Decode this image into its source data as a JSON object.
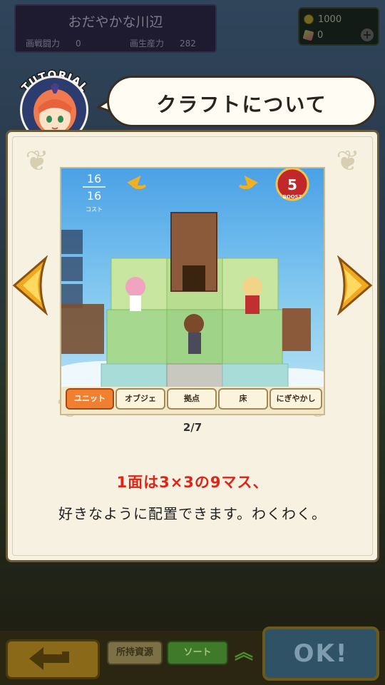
{
  "header": {
    "area_name": "おだやかな川辺",
    "defense_label": "画戦闘力",
    "defense_value": "0",
    "production_label": "画生産力",
    "production_value": "282"
  },
  "currency": {
    "coins": "1000",
    "gems": "0"
  },
  "tutorial": {
    "badge": "TUTORIAL",
    "title": "クラフトについて"
  },
  "preview": {
    "cost_current": "16",
    "cost_max": "16",
    "cost_label": "コスト",
    "boost_number": "5",
    "boost_label": "BOOST",
    "tabs": [
      "ユニット",
      "オブジェ",
      "拠点",
      "床",
      "にぎやかし"
    ]
  },
  "page_indicator": "2/7",
  "description": {
    "line1": "1面は3×3の9マス、",
    "line2": "好きなように配置できます。わくわく。"
  },
  "bottom_bar": {
    "owned_resources_label": "所持資源",
    "sort_label": "ソート",
    "ok_label": "OK!"
  },
  "colors": {
    "accent_red": "#e02418",
    "panel_bg": "#f6f1e0",
    "arrow_gold": "#f0a820"
  }
}
